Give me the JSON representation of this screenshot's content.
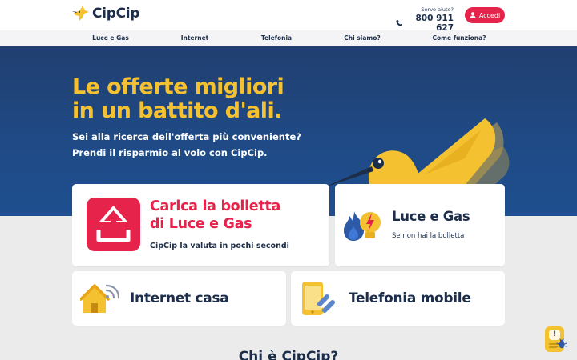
{
  "header": {
    "logo_text": "CipCip",
    "help_label": "Serve aiuto?",
    "phone": "800 911 627",
    "login_label": "Accedi"
  },
  "nav": {
    "items": [
      {
        "label": "Luce e Gas"
      },
      {
        "label": "Internet"
      },
      {
        "label": "Telefonia"
      },
      {
        "label": "Chi siamo?"
      },
      {
        "label": "Come funziona?"
      }
    ]
  },
  "hero": {
    "title": "Le offerte migliori\nin un battito d'ali.",
    "subtitle": "Sei alla ricerca dell'offerta più conveniente?\nPrendi il risparmio al volo con CipCip."
  },
  "cards": {
    "upload": {
      "title": "Carica la bolletta\ndi Luce e Gas",
      "subtitle": "CipCip la valuta in pochi secondi",
      "icon": "upload-icon"
    },
    "gas": {
      "title": "Luce e Gas",
      "subtitle": "Se non hai la bolletta",
      "icon": "flame-bolt-icon"
    },
    "internet": {
      "title": "Internet casa",
      "icon": "house-wifi-icon"
    },
    "mobile": {
      "title": "Telefonia mobile",
      "icon": "smartphone-link-icon"
    }
  },
  "section": {
    "title": "Chi è CipCip?"
  },
  "chat": {
    "badge": "!"
  },
  "colors": {
    "brand_navy": "#1c2e4a",
    "brand_yellow": "#f4c131",
    "accent_red": "#e6234a",
    "hero_blue": "#1f4a85",
    "page_bg": "#ebebeb"
  }
}
